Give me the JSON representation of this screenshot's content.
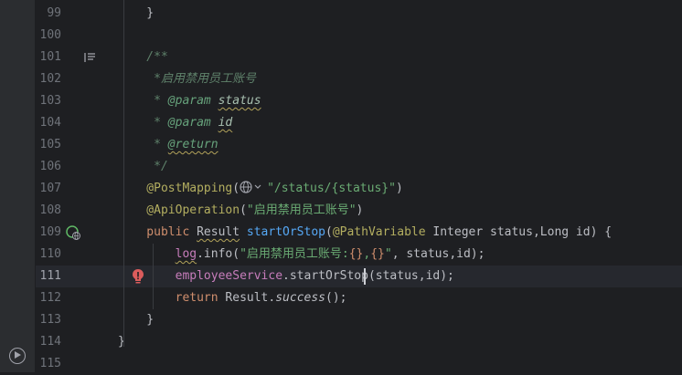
{
  "sidebar": {
    "run_icon": "run-tool-icon"
  },
  "lines": [
    {
      "num": "99",
      "code": [
        {
          "t": "    }",
          "c": ""
        }
      ]
    },
    {
      "num": "100",
      "code": []
    },
    {
      "num": "101",
      "code": [
        {
          "t": "    /**",
          "c": "doc"
        }
      ]
    },
    {
      "num": "102",
      "code": [
        {
          "t": "     *启用禁用员工账号",
          "c": "doc"
        }
      ]
    },
    {
      "num": "103",
      "code": [
        {
          "t": "     * ",
          "c": "doc"
        },
        {
          "t": "@param",
          "c": "doctag"
        },
        {
          "t": " ",
          "c": "doc"
        },
        {
          "t": "status",
          "c": "docparam underline-warn"
        }
      ]
    },
    {
      "num": "104",
      "code": [
        {
          "t": "     * ",
          "c": "doc"
        },
        {
          "t": "@param",
          "c": "doctag"
        },
        {
          "t": " ",
          "c": "doc"
        },
        {
          "t": "id",
          "c": "docparam underline-warn"
        }
      ]
    },
    {
      "num": "105",
      "code": [
        {
          "t": "     * ",
          "c": "doc"
        },
        {
          "t": "@return",
          "c": "doctag underline-warn"
        }
      ]
    },
    {
      "num": "106",
      "code": [
        {
          "t": "     */",
          "c": "doc"
        }
      ]
    },
    {
      "num": "107",
      "code": [
        {
          "t": "    @PostMapping",
          "c": "ann"
        },
        {
          "t": "(",
          "c": ""
        },
        {
          "t": "🌐∨",
          "c": "globe"
        },
        {
          "t": "\"/status/{status}\"",
          "c": "str"
        },
        {
          "t": ")",
          "c": ""
        }
      ]
    },
    {
      "num": "108",
      "code": [
        {
          "t": "    @ApiOperation",
          "c": "ann"
        },
        {
          "t": "(",
          "c": ""
        },
        {
          "t": "\"启用禁用员工账号\"",
          "c": "str"
        },
        {
          "t": ")",
          "c": ""
        }
      ]
    },
    {
      "num": "109",
      "code": [
        {
          "t": "    public ",
          "c": "kw"
        },
        {
          "t": "Result",
          "c": "underline-warn"
        },
        {
          "t": " ",
          "c": ""
        },
        {
          "t": "startOrStop",
          "c": "fn"
        },
        {
          "t": "(",
          "c": ""
        },
        {
          "t": "@PathVariable",
          "c": "ann"
        },
        {
          "t": " Integer status,Long id) {",
          "c": ""
        }
      ]
    },
    {
      "num": "110",
      "code": [
        {
          "t": "        ",
          "c": ""
        },
        {
          "t": "log",
          "c": "field underline-warn"
        },
        {
          "t": ".info(",
          "c": ""
        },
        {
          "t": "\"启用禁用员工账号:",
          "c": "str"
        },
        {
          "t": "{}",
          "c": "placeholder"
        },
        {
          "t": ",",
          "c": "str"
        },
        {
          "t": "{}",
          "c": "placeholder"
        },
        {
          "t": "\"",
          "c": "str"
        },
        {
          "t": ", status,id);",
          "c": ""
        }
      ]
    },
    {
      "num": "111",
      "code": [
        {
          "t": "        ",
          "c": ""
        },
        {
          "t": "employeeService",
          "c": "field"
        },
        {
          "t": ".startOrStop(status,id);",
          "c": ""
        }
      ],
      "current": true
    },
    {
      "num": "112",
      "code": [
        {
          "t": "        ",
          "c": ""
        },
        {
          "t": "return ",
          "c": "kw"
        },
        {
          "t": "Result.",
          "c": ""
        },
        {
          "t": "success",
          "c": "italic"
        },
        {
          "t": "();",
          "c": ""
        }
      ]
    },
    {
      "num": "113",
      "code": [
        {
          "t": "    }",
          "c": ""
        }
      ]
    },
    {
      "num": "114",
      "code": [
        {
          "t": "}",
          "c": ""
        }
      ]
    },
    {
      "num": "115",
      "code": []
    }
  ]
}
